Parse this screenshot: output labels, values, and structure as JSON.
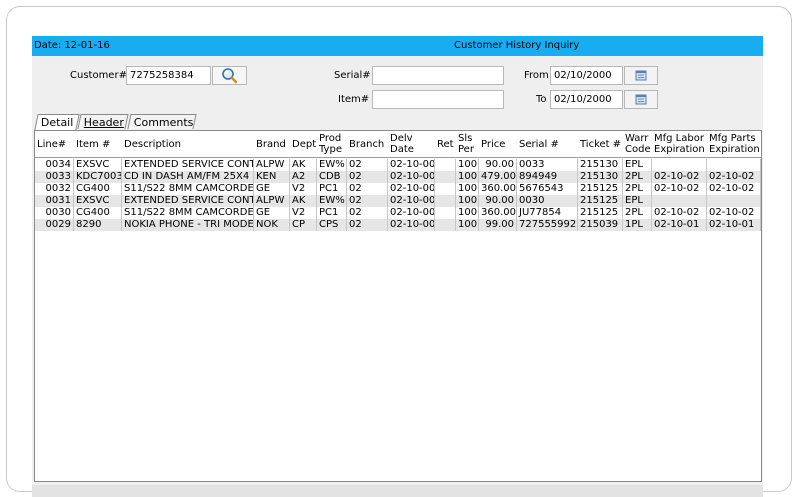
{
  "header": {
    "date": "Date: 12-01-16",
    "title": "Customer History Inquiry"
  },
  "form": {
    "customer_label": "Customer#",
    "customer_value": "7275258384",
    "serial_label": "Serial#",
    "serial_value": "",
    "item_label": "Item#",
    "item_value": "",
    "from_label": "From",
    "from_value": "02/10/2000",
    "to_label": "To",
    "to_value": "02/10/2000"
  },
  "tabs": [
    "Detail",
    "Header",
    "Comments"
  ],
  "columns": {
    "line": "Line#",
    "item": "Item #",
    "desc": "Description",
    "brand": "Brand",
    "dept": "Dept",
    "prod1": "Prod",
    "prod2": "Type",
    "branch": "Branch",
    "delv1": "Delv",
    "delv2": "Date",
    "ret": "Ret",
    "sls1": "Sls",
    "sls2": "Per",
    "price": "Price",
    "serial": "Serial #",
    "ticket": "Ticket #",
    "warr1": "Warr",
    "warr2": "Code",
    "labor1": "Mfg Labor",
    "labor2": "Expiration",
    "parts1": "Mfg Parts",
    "parts2": "Expiration"
  },
  "rows": [
    {
      "line": "0034",
      "item": "EXSVC",
      "desc": "EXTENDED SERVICE CONTR",
      "brand": "ALPW",
      "dept": "AK",
      "prod": "EW%",
      "branch": "02",
      "delv": "02-10-00",
      "ret": "",
      "sls": "100",
      "price": "90.00",
      "serial": "0033",
      "ticket": "215130",
      "warr": "EPL",
      "labor": "",
      "parts": ""
    },
    {
      "line": "0033",
      "item": "KDC7003",
      "desc": "CD IN DASH AM/FM 25X4",
      "brand": "KEN",
      "dept": "A2",
      "prod": "CDB",
      "branch": "02",
      "delv": "02-10-00",
      "ret": "",
      "sls": "100",
      "price": "479.00",
      "serial": "894949",
      "ticket": "215130",
      "warr": "2PL",
      "labor": "02-10-02",
      "parts": "02-10-02"
    },
    {
      "line": "0032",
      "item": "CG400",
      "desc": "S11/S22 8MM CAMCORDER",
      "brand": "GE",
      "dept": "V2",
      "prod": "PC1",
      "branch": "02",
      "delv": "02-10-00",
      "ret": "",
      "sls": "100",
      "price": "360.00",
      "serial": "5676543",
      "ticket": "215125",
      "warr": "2PL",
      "labor": "02-10-02",
      "parts": "02-10-02"
    },
    {
      "line": "0031",
      "item": "EXSVC",
      "desc": "EXTENDED SERVICE CONTR",
      "brand": "ALPW",
      "dept": "AK",
      "prod": "EW%",
      "branch": "02",
      "delv": "02-10-00",
      "ret": "",
      "sls": "100",
      "price": "90.00",
      "serial": "0030",
      "ticket": "215125",
      "warr": "EPL",
      "labor": "",
      "parts": ""
    },
    {
      "line": "0030",
      "item": "CG400",
      "desc": "S11/S22 8MM CAMCORDER",
      "brand": "GE",
      "dept": "V2",
      "prod": "PC1",
      "branch": "02",
      "delv": "02-10-00",
      "ret": "",
      "sls": "100",
      "price": "360.00",
      "serial": "JU77854",
      "ticket": "215125",
      "warr": "2PL",
      "labor": "02-10-02",
      "parts": "02-10-02"
    },
    {
      "line": "0029",
      "item": "8290",
      "desc": "NOKIA PHONE - TRI MODE",
      "brand": "NOK",
      "dept": "CP",
      "prod": "CPS",
      "branch": "02",
      "delv": "02-10-00",
      "ret": "",
      "sls": "100",
      "price": "99.00",
      "serial": "7275559922",
      "ticket": "215039",
      "warr": "1PL",
      "labor": "02-10-01",
      "parts": "02-10-01"
    }
  ],
  "colors": {
    "titlebar": "#18adf1",
    "panel": "#efefef",
    "row_alt": "#e6e6e6"
  },
  "icons": {
    "search": "magnifier-icon",
    "calendar": "calendar-icon"
  }
}
